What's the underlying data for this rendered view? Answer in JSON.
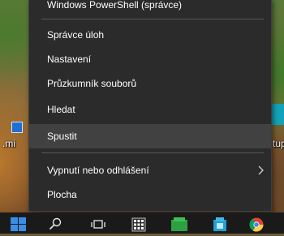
{
  "desktop": {
    "left_label": ".mi",
    "right_label": "tup"
  },
  "menu": {
    "items": [
      {
        "label": "Windows PowerShell (správce)"
      },
      {
        "label": "Správce úloh"
      },
      {
        "label": "Nastavení"
      },
      {
        "label": "Průzkumník souborů"
      },
      {
        "label": "Hledat"
      },
      {
        "label": "Spustit"
      },
      {
        "label": "Vypnutí nebo odhlášení"
      },
      {
        "label": "Plocha"
      }
    ],
    "hovered_item": "Spustit"
  },
  "taskbar": {
    "icons": [
      "windows-start-icon",
      "search-icon",
      "task-view-icon",
      "calculator-icon",
      "green-app-icon",
      "store-icon",
      "chrome-icon"
    ]
  },
  "colors": {
    "menu_bg": "#2b2b2b",
    "menu_hover": "#414141",
    "separator": "#575757",
    "text": "#ffffff",
    "taskbar": "#1a1a1a",
    "accent": "#3a8ee6"
  }
}
